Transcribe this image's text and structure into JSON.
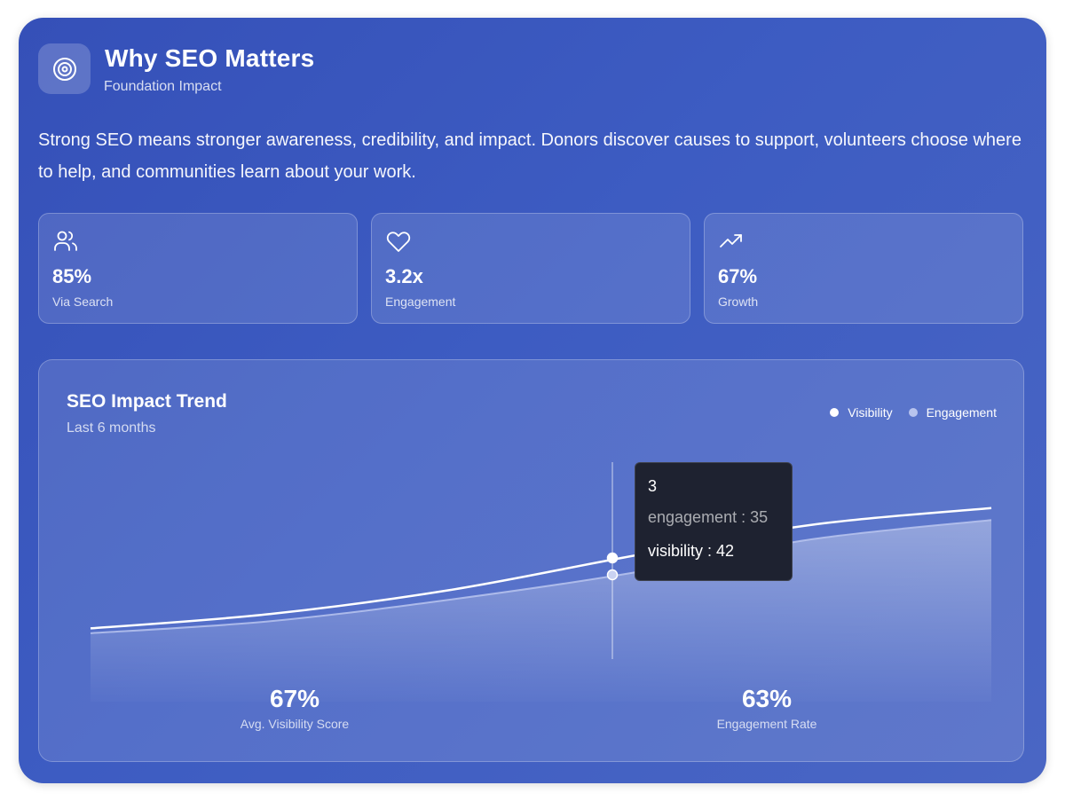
{
  "header": {
    "title": "Why SEO Matters",
    "subtitle": "Foundation Impact",
    "icon": "target-icon"
  },
  "description": "Strong SEO means stronger awareness, credibility, and impact. Donors discover causes to support, volunteers choose where to help, and communities learn about your work.",
  "stats": [
    {
      "icon": "users-icon",
      "value": "85%",
      "label": "Via Search"
    },
    {
      "icon": "heart-icon",
      "value": "3.2x",
      "label": "Engagement"
    },
    {
      "icon": "trending-up-icon",
      "value": "67%",
      "label": "Growth"
    }
  ],
  "chart": {
    "title": "SEO Impact Trend",
    "subtitle": "Last 6 months",
    "legend": [
      "Visibility",
      "Engagement"
    ],
    "tooltip": {
      "label": "3",
      "engagement_text": "engagement : 35",
      "visibility_text": "visibility : 42"
    },
    "metrics": [
      {
        "value": "67%",
        "label": "Avg. Visibility Score"
      },
      {
        "value": "63%",
        "label": "Engagement Rate"
      }
    ]
  },
  "chart_data": {
    "type": "area",
    "x": [
      0,
      1,
      2,
      3,
      4,
      5
    ],
    "series": [
      {
        "name": "Visibility",
        "values": [
          12,
          18,
          28,
          42,
          55,
          62
        ],
        "color": "#ffffff"
      },
      {
        "name": "Engagement",
        "values": [
          10,
          15,
          24,
          35,
          49,
          57
        ],
        "color": "#b8c4ee"
      }
    ],
    "active_index": 3,
    "ylim": [
      0,
      70
    ],
    "grid": false,
    "legend_position": "top-right"
  },
  "colors": {
    "background": "#3d5cc2",
    "tooltip_bg": "#1e2230",
    "visibility": "#ffffff",
    "engagement": "#b8c4ee"
  }
}
